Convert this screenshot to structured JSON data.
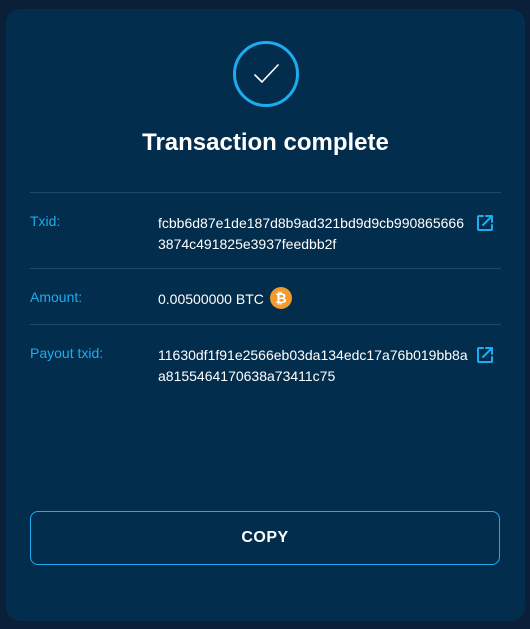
{
  "title": "Transaction complete",
  "rows": {
    "txid": {
      "label": "Txid:",
      "value": "fcbb6d87e1de187d8b9ad321bd9d9cb9908656663874c491825e3937feedbb2f",
      "icon": "external-link-icon"
    },
    "amount": {
      "label": "Amount:",
      "value": "0.00500000 BTC",
      "icon": "bitcoin-icon",
      "icon_glyph": "₿"
    },
    "payout_txid": {
      "label": "Payout txid:",
      "value": "11630df1f91e2566eb03da134edc17a76b019bb8aa8155464170638a73411c75",
      "icon": "external-link-icon"
    }
  },
  "copy_button": "COPY",
  "colors": {
    "background": "#0b2038",
    "card": "#032d4d",
    "accent": "#1dacef",
    "bitcoin": "#f39a2d",
    "text": "#ffffff"
  }
}
